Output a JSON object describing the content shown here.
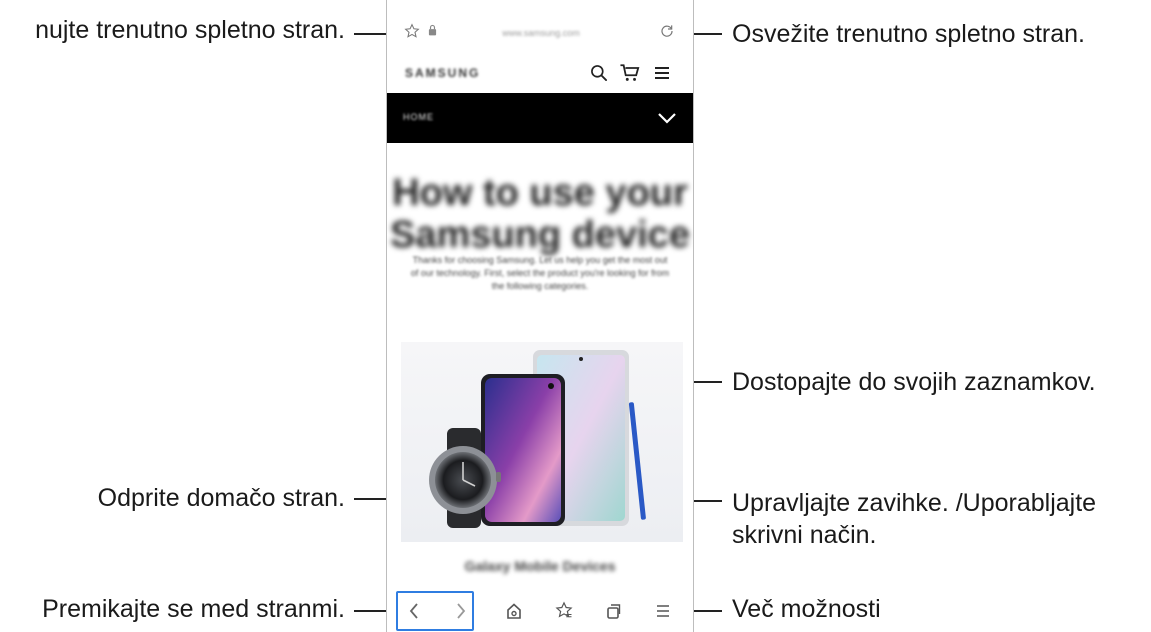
{
  "callouts": {
    "bookmark_add": "nujte trenutno spletno stran.",
    "refresh": "Osvežite trenutno spletno stran.",
    "bookmarks": "Dostopajte do svojih zaznamkov.",
    "home": "Odprite domačo stran.",
    "tabs_line1": "Upravljajte zavihke. /Uporabljajte",
    "tabs_line2": "skrivni način.",
    "navigate": "Premikajte se med stranmi.",
    "more": "Več možnosti"
  },
  "browser": {
    "url": "www.samsung.com",
    "site_logo": "SAMSUNG",
    "nav_label": "HOME",
    "hero_title_line1": "How to use your",
    "hero_title_line2": "Samsung device",
    "hero_subtitle": "Thanks for choosing Samsung. Let us help you get the most out of our technology. First, select the product you're looking for from the following categories.",
    "caption": "Galaxy Mobile Devices"
  },
  "colors": {
    "nav_highlight": "#2f7de1",
    "nav_strip": "#000000"
  }
}
